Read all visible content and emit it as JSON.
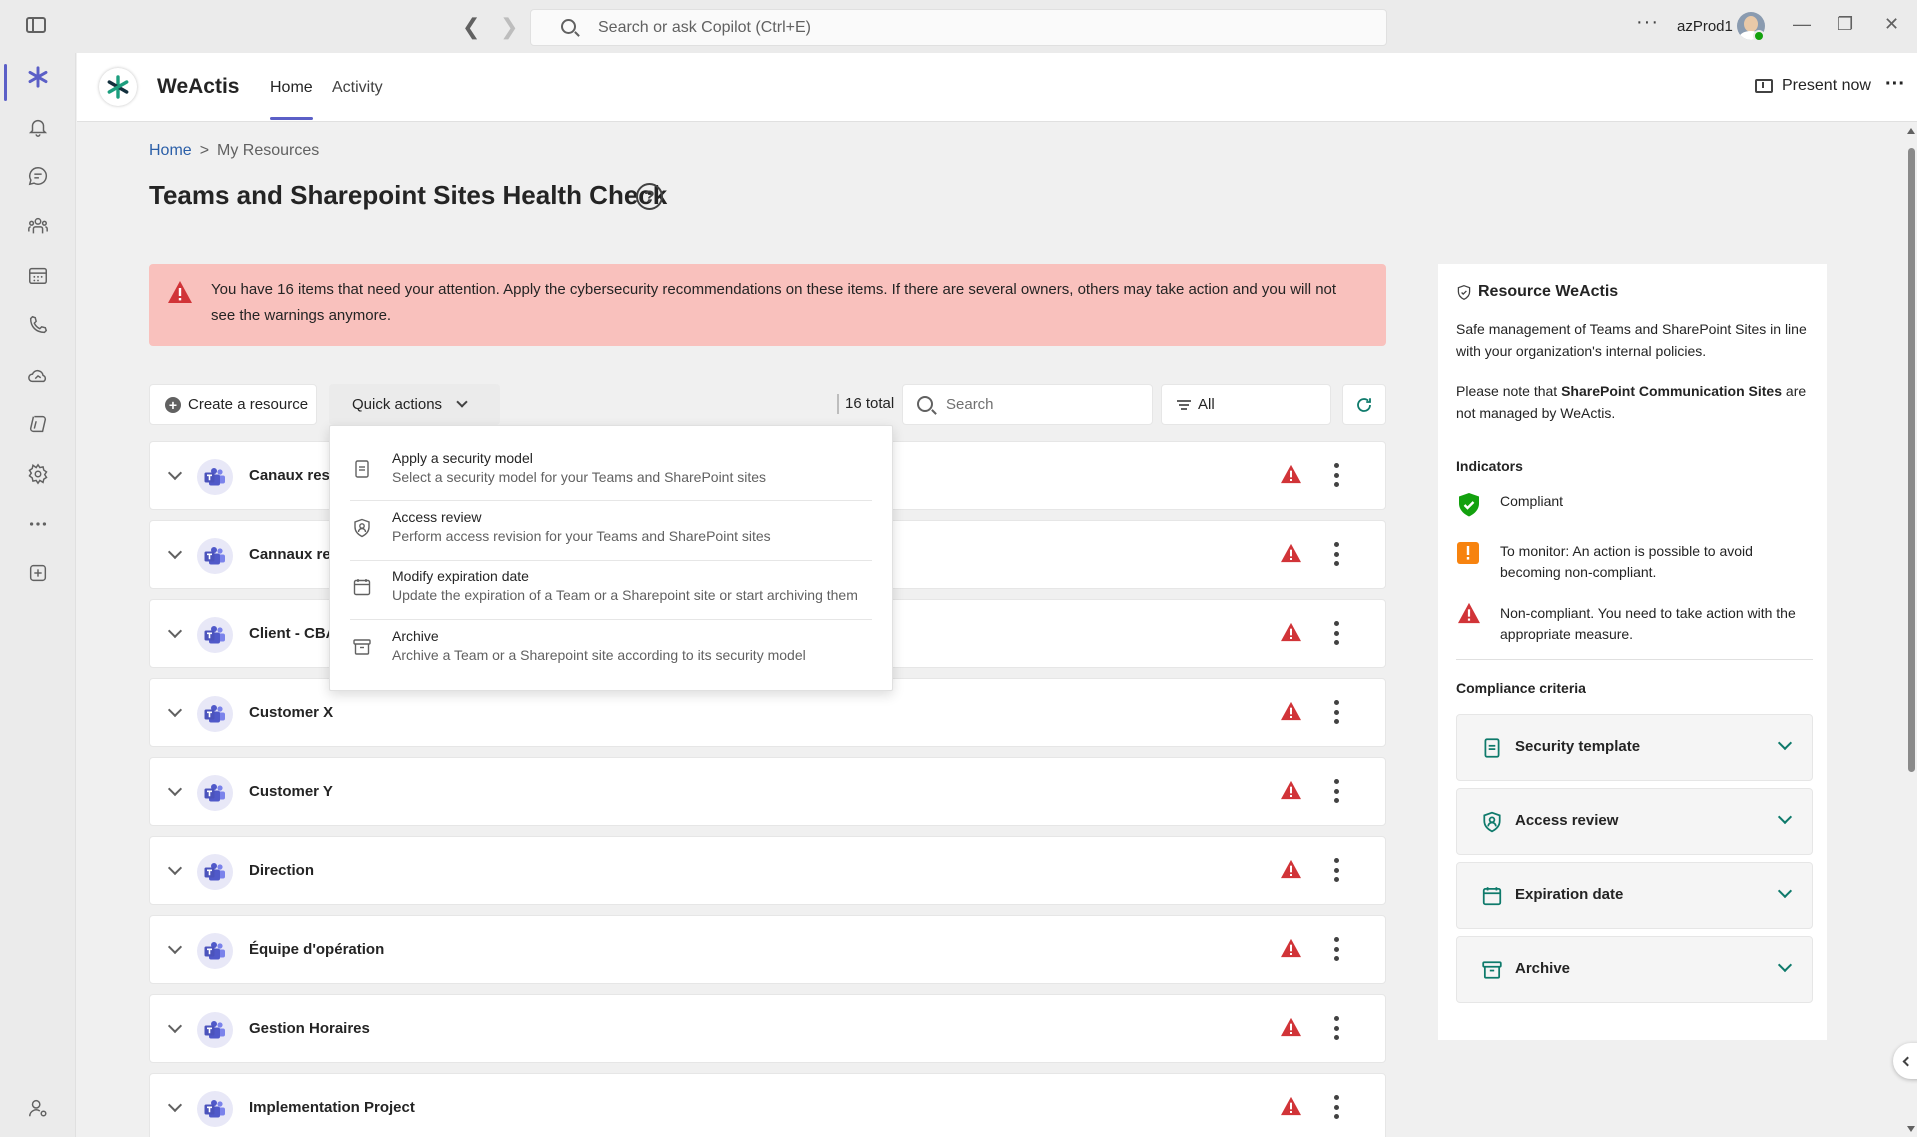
{
  "titlebar": {
    "search_placeholder": "Search or ask Copilot (Ctrl+E)",
    "more_label": "···",
    "user_name": "azProd1",
    "back_glyph": "❮",
    "forward_glyph": "❯",
    "minimize_glyph": "—",
    "restore_glyph": "❐",
    "close_glyph": "✕"
  },
  "rail": {
    "items": [
      "weactis-app",
      "activity",
      "chat",
      "teams",
      "calendar",
      "calls",
      "onedrive",
      "copilot",
      "apps-settings",
      "more-apps",
      "add-apps"
    ],
    "bottom": "admin"
  },
  "app": {
    "name": "WeActis",
    "tabs": [
      {
        "label": "Home",
        "active": true
      },
      {
        "label": "Activity",
        "active": false
      }
    ],
    "present_now": "Present now",
    "more": "···"
  },
  "breadcrumb": {
    "home": "Home",
    "separator": ">",
    "current": "My Resources"
  },
  "page": {
    "title": "Teams and Sharepoint Sites Health Check",
    "help": "?"
  },
  "alert": {
    "text": "You have 16 items that need your attention. Apply the cybersecurity recommendations on these items. If there are several owners, others may take action and you will not see the warnings anymore.",
    "color": "#f9c1bd"
  },
  "toolbar": {
    "create": "Create a resource",
    "plus": "+",
    "quick_actions": "Quick actions",
    "total": "16 total",
    "search_placeholder": "Search",
    "filter": "All"
  },
  "resources": [
    {
      "name": "Canaux rest"
    },
    {
      "name": "Cannaux res"
    },
    {
      "name": "Client - CBA"
    },
    {
      "name": "Customer X"
    },
    {
      "name": "Customer Y"
    },
    {
      "name": "Direction"
    },
    {
      "name": "Équipe d'opération"
    },
    {
      "name": "Gestion Horaires"
    },
    {
      "name": "Implementation Project"
    }
  ],
  "quick_actions_menu": [
    {
      "title": "Apply a security model",
      "desc": "Select a security model for your Teams and SharePoint sites",
      "icon": "document-icon"
    },
    {
      "title": "Access review",
      "desc": "Perform access revision for your Teams and SharePoint sites",
      "icon": "shield-person-icon"
    },
    {
      "title": "Modify expiration date",
      "desc": "Update the expiration of a Team or a Sharepoint site or start archiving them",
      "icon": "calendar-icon"
    },
    {
      "title": "Archive",
      "desc": "Archive a Team or a Sharepoint site according to its security model",
      "icon": "archive-icon"
    }
  ],
  "panel": {
    "title": "Resource WeActis",
    "intro": "Safe management of Teams and SharePoint Sites in line with your organization's internal policies.",
    "note_pre": "Please note that ",
    "note_bold": "SharePoint Communication Sites",
    "note_post": " are not managed by WeActis.",
    "indicators_heading": "Indicators",
    "indicators": [
      {
        "label": "Compliant",
        "color": "#13a10e"
      },
      {
        "label": "To monitor: An action is possible to avoid becoming non-compliant.",
        "color": "#f7830f"
      },
      {
        "label": "Non-compliant. You need to take action with the appropriate measure.",
        "color": "#d13438"
      }
    ],
    "criteria_heading": "Compliance criteria",
    "criteria": [
      {
        "label": "Security template",
        "icon": "document-icon"
      },
      {
        "label": "Access review",
        "icon": "shield-person-icon"
      },
      {
        "label": "Expiration date",
        "icon": "calendar-icon"
      },
      {
        "label": "Archive",
        "icon": "archive-icon"
      }
    ],
    "accent": "#0e7a6b"
  },
  "colors": {
    "brand": "#5b5fc7",
    "link": "#2b5fa8",
    "warning": "#d13438"
  }
}
